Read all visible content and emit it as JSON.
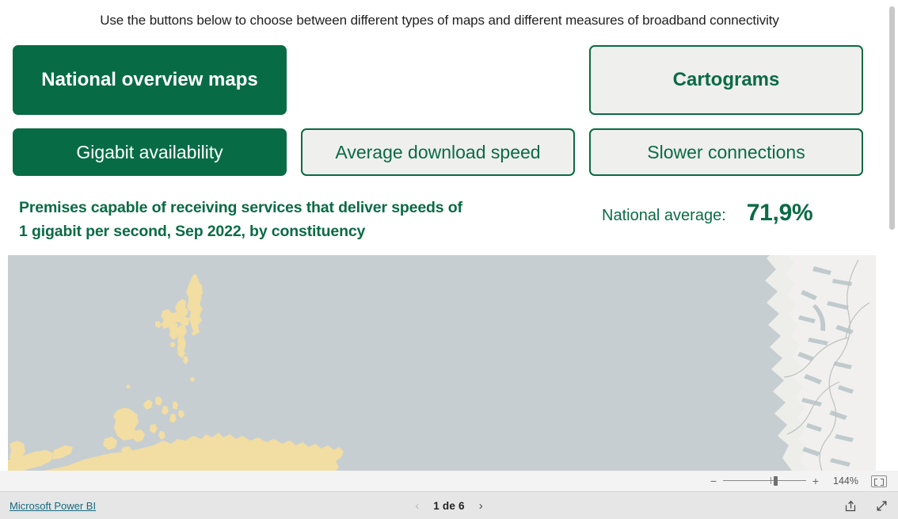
{
  "instruction": "Use the buttons below to choose between different types of maps and different measures of broadband connectivity",
  "map_type_buttons": [
    {
      "label": "National overview maps",
      "selected": true
    },
    {
      "label": "Cartograms",
      "selected": false
    }
  ],
  "measure_buttons": [
    {
      "label": "Gigabit availability",
      "selected": true
    },
    {
      "label": "Average download speed",
      "selected": false
    },
    {
      "label": "Slower connections",
      "selected": false
    }
  ],
  "chart": {
    "title_line1": "Premises capable of receiving services that deliver speeds of",
    "title_line2": "1 gigabit per second, Sep 2022, by constituency",
    "national_average_label": "National average:",
    "national_average_value": "71,9%"
  },
  "map": {
    "sea_color": "#c6ced1",
    "land_highlight_color": "#f2dda2",
    "land_neutral_color": "#ededea",
    "border_color": "#b9bdbd"
  },
  "colors": {
    "brand_green": "#076C45",
    "button_unselected_fill": "#efefee",
    "link_teal": "#17697f"
  },
  "zoom_bar": {
    "minus_label": "−",
    "plus_label": "+",
    "zoom_level": "144%",
    "fit_icon": "fit-to-page-icon"
  },
  "footer": {
    "powerbi_link": "Microsoft Power BI",
    "prev_chevron": "‹",
    "next_chevron": "›",
    "page_label": "1 de 6",
    "share_icon": "share-icon",
    "fullscreen_icon": "fullscreen-icon"
  }
}
